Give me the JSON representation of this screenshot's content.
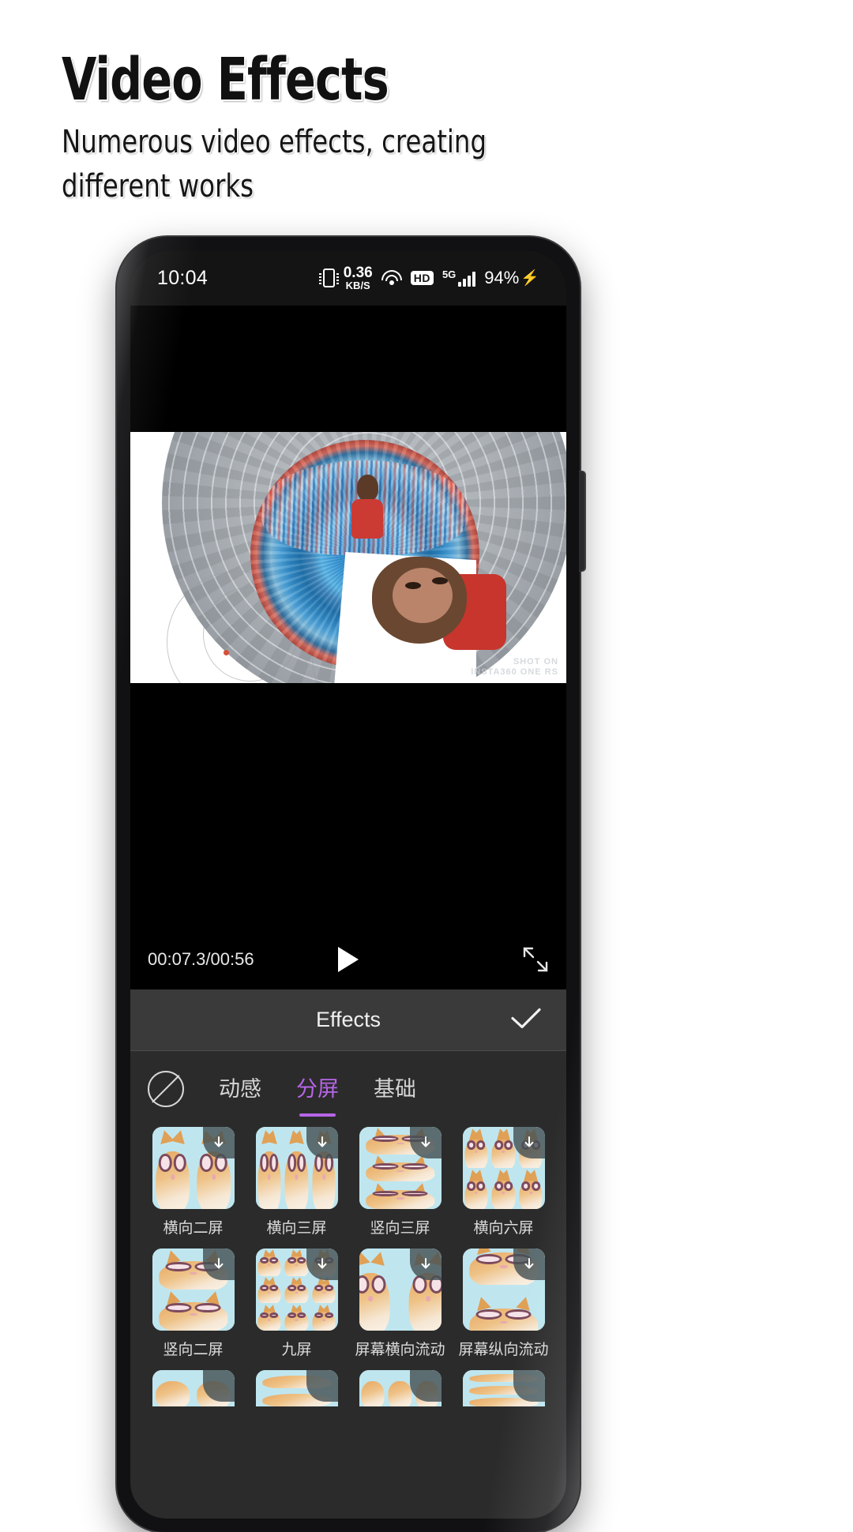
{
  "promo": {
    "title": "Video Effects",
    "subtitle": "Numerous video effects, creating different works"
  },
  "statusbar": {
    "time": "10:04",
    "vibrate_icon": "vibrate-icon",
    "net_speed_value": "0.36",
    "net_speed_unit": "KB/S",
    "wifi_icon": "wifi-icon",
    "hd_badge": "HD",
    "network_type": "5G",
    "signal_icon": "signal-bars-icon",
    "battery": "94%",
    "charging_icon": "⚡"
  },
  "player": {
    "time_display": "00:07.3/00:56",
    "play_icon": "play-icon",
    "expand_icon": "fullscreen-expand-icon",
    "watermark_line1": "SHOT ON",
    "watermark_line2": "INSTA360 ONE RS",
    "brand_watermark": "insta360"
  },
  "effects_header": {
    "title": "Effects",
    "confirm_icon": "check-icon"
  },
  "tabs": {
    "none_icon": "no-effect-icon",
    "items": [
      {
        "label": "动感",
        "active": false
      },
      {
        "label": "分屏",
        "active": true
      },
      {
        "label": "基础",
        "active": false
      }
    ],
    "active_color": "#b765e8"
  },
  "effects_grid": {
    "download_icon": "download-arrow-icon",
    "rows": [
      [
        {
          "label": "横向二屏",
          "pattern": "p-h2",
          "tiles": 2
        },
        {
          "label": "横向三屏",
          "pattern": "p-h3",
          "tiles": 3
        },
        {
          "label": "竖向三屏",
          "pattern": "p-v3",
          "tiles": 3
        },
        {
          "label": "横向六屏",
          "pattern": "p-h6",
          "tiles": 6
        }
      ],
      [
        {
          "label": "竖向二屏",
          "pattern": "p-v2",
          "tiles": 2
        },
        {
          "label": "九屏",
          "pattern": "p-n9",
          "tiles": 9
        },
        {
          "label": "屏幕横向流动",
          "pattern": "p-fh",
          "tiles": 2
        },
        {
          "label": "屏幕纵向流动",
          "pattern": "p-fv",
          "tiles": 2
        }
      ],
      [
        {
          "label": "",
          "pattern": "p-h2",
          "tiles": 2
        },
        {
          "label": "",
          "pattern": "p-v2",
          "tiles": 2
        },
        {
          "label": "",
          "pattern": "p-h3",
          "tiles": 3
        },
        {
          "label": "",
          "pattern": "p-v3",
          "tiles": 3
        }
      ]
    ]
  }
}
